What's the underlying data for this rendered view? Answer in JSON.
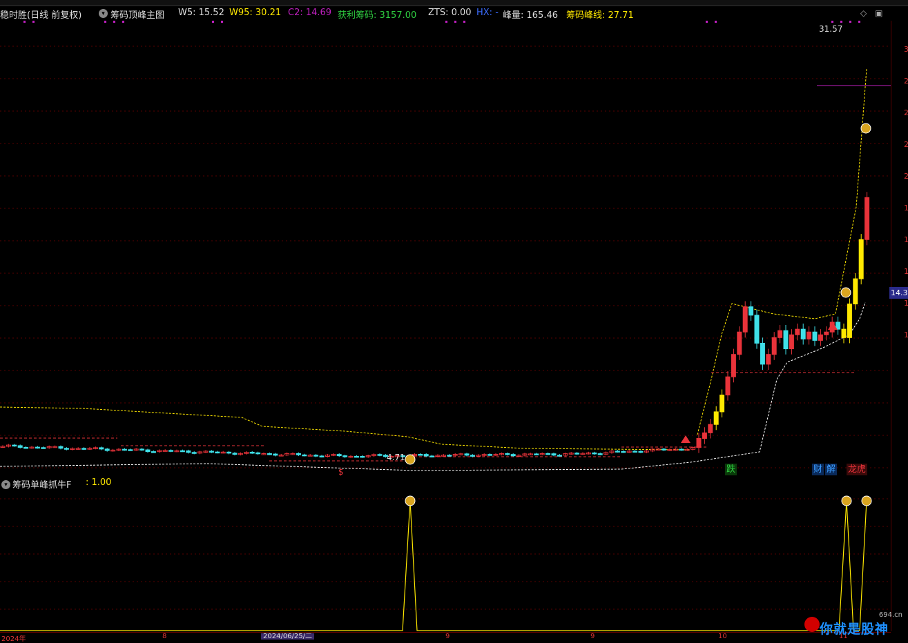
{
  "header": {
    "stock_name": "稳时胜(日线 前复权)",
    "indicator_name": "筹码顶峰主图",
    "w5": "W5: 15.52",
    "w95": "W95: 30.21",
    "c2": "C2: 14.69",
    "profit_chips": "获利筹码: 3157.00",
    "zts": "ZTS: 0.00",
    "hx": "HX: -",
    "peak_volume": "峰量: 165.46",
    "peak_line": "筹码峰线: 27.71"
  },
  "colors": {
    "up": "#e8333a",
    "down": "#3fe0e8",
    "yellow": "#ffe800",
    "white": "#ffffff",
    "magenta": "#c020c0",
    "green": "#2ecc40",
    "blue": "#3b6cff",
    "axis": "#7a0000"
  },
  "annotations": {
    "high_label": "31.57",
    "low_label": "4.71",
    "current_price": "14.3",
    "event_fall": "跌",
    "event_finance": "财",
    "event_unlock": "解",
    "event_rank": "龙虎",
    "money_bag": "$"
  },
  "sub_header": {
    "name": "筹码单峰抓牛F",
    "value": ": 1.00"
  },
  "date_axis": {
    "year": "2024年",
    "cursor_date": "2024/06/25/二",
    "m1": "8",
    "m2": "9",
    "m3": "9",
    "m4": "10",
    "m5": "11"
  },
  "right_axis_ticks": [
    "3",
    "2",
    "2",
    "2",
    "2",
    "1",
    "1",
    "1",
    "1",
    "1"
  ],
  "watermark": {
    "site": "694.cn",
    "text": "你就是股神"
  }
}
